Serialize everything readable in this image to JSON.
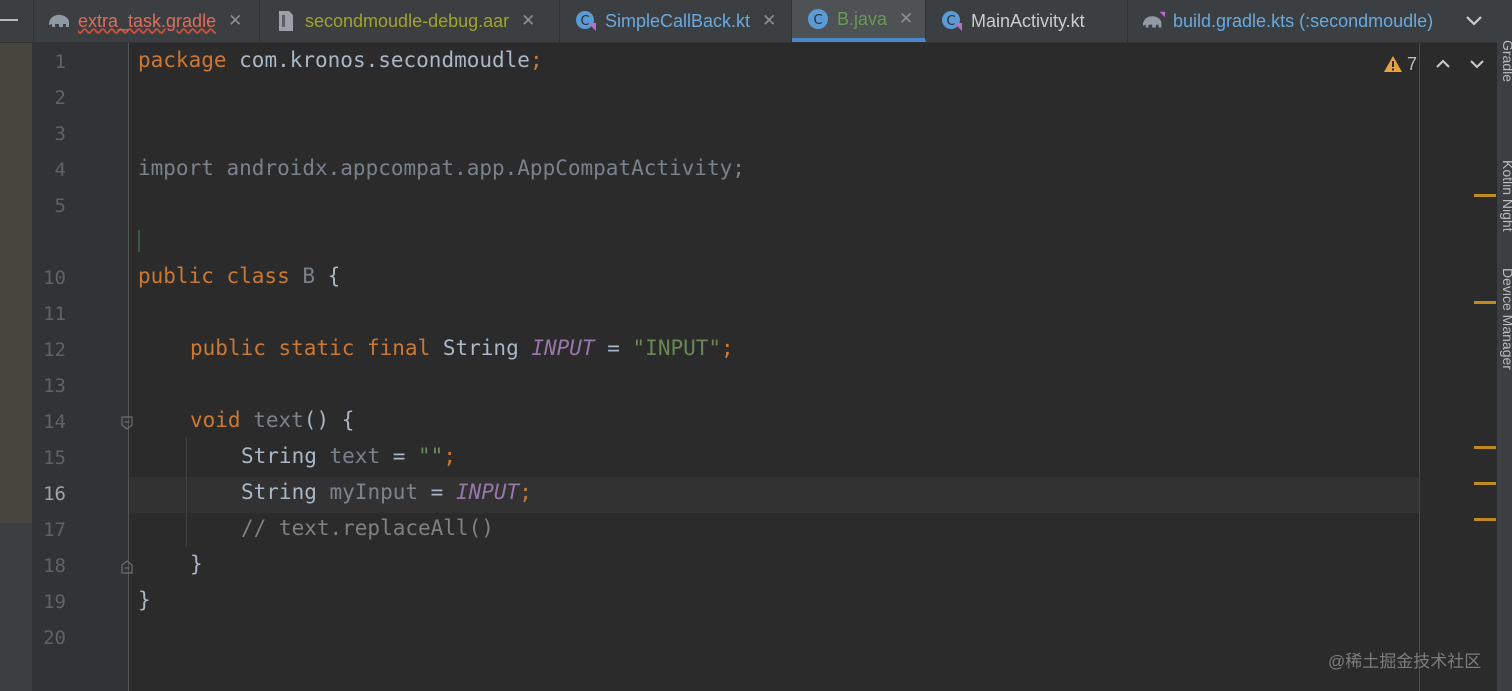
{
  "tabs": [
    {
      "label": "extra_task.gradle",
      "icon": "gradle-elephant-icon",
      "color": "#e06c5c",
      "active": false
    },
    {
      "label": "secondmoudle-debug.aar",
      "icon": "archive-file-icon",
      "color": "#a3a22b",
      "active": false
    },
    {
      "label": "SimpleCallBack.kt",
      "icon": "kotlin-class-icon",
      "color": "#6aa9e0",
      "active": false
    },
    {
      "label": "B.java",
      "icon": "java-class-icon",
      "color": "#6a9955",
      "active": true
    },
    {
      "label": "MainActivity.kt",
      "icon": "kotlin-class-icon",
      "color": "#c9ccd0",
      "active": false
    },
    {
      "label": "build.gradle.kts (:secondmoudle)",
      "icon": "gradle-kts-icon",
      "color": "#6aa9e0",
      "active": false
    }
  ],
  "editor": {
    "line_numbers": [
      "1",
      "2",
      "3",
      "4",
      "5",
      "10",
      "11",
      "12",
      "13",
      "14",
      "15",
      "16",
      "17",
      "18",
      "19",
      "20"
    ],
    "current_line": "16",
    "code": {
      "l1_kw": "package",
      "l1_rest": " com.kronos.secondmoudle",
      "l1_semi": ";",
      "l4_import": "import androidx.appcompat.app.AppCompatActivity;",
      "l10_kw": "public class",
      "l10_name": " B",
      "l10_brace": " {",
      "l12_kw": "public static final",
      "l12_type": " String ",
      "l12_field": "INPUT",
      "l12_eq": " = ",
      "l12_str": "\"INPUT\"",
      "l12_semi": ";",
      "l14_kw": "void",
      "l14_name": " text",
      "l14_rest": "() {",
      "l15_type": "String ",
      "l15_var": "text",
      "l15_eq": " = ",
      "l15_str": "\"\"",
      "l15_semi": ";",
      "l16_type": "String ",
      "l16_var": "myInput",
      "l16_eq": " = ",
      "l16_field": "INPUT",
      "l16_semi": ";",
      "l17_comment": "// text.replaceAll()",
      "l18_close": "}",
      "l19_close": "}"
    }
  },
  "inspection": {
    "warning_count": "7"
  },
  "right_panel": {
    "labels": [
      "Gradle",
      "Kotlin Night",
      "Device Manager"
    ]
  },
  "watermark": "@稀土掘金技术社区",
  "colors": {
    "accent": "#4a88c7",
    "warning": "#e8a33d",
    "keyword": "#cc7832"
  }
}
